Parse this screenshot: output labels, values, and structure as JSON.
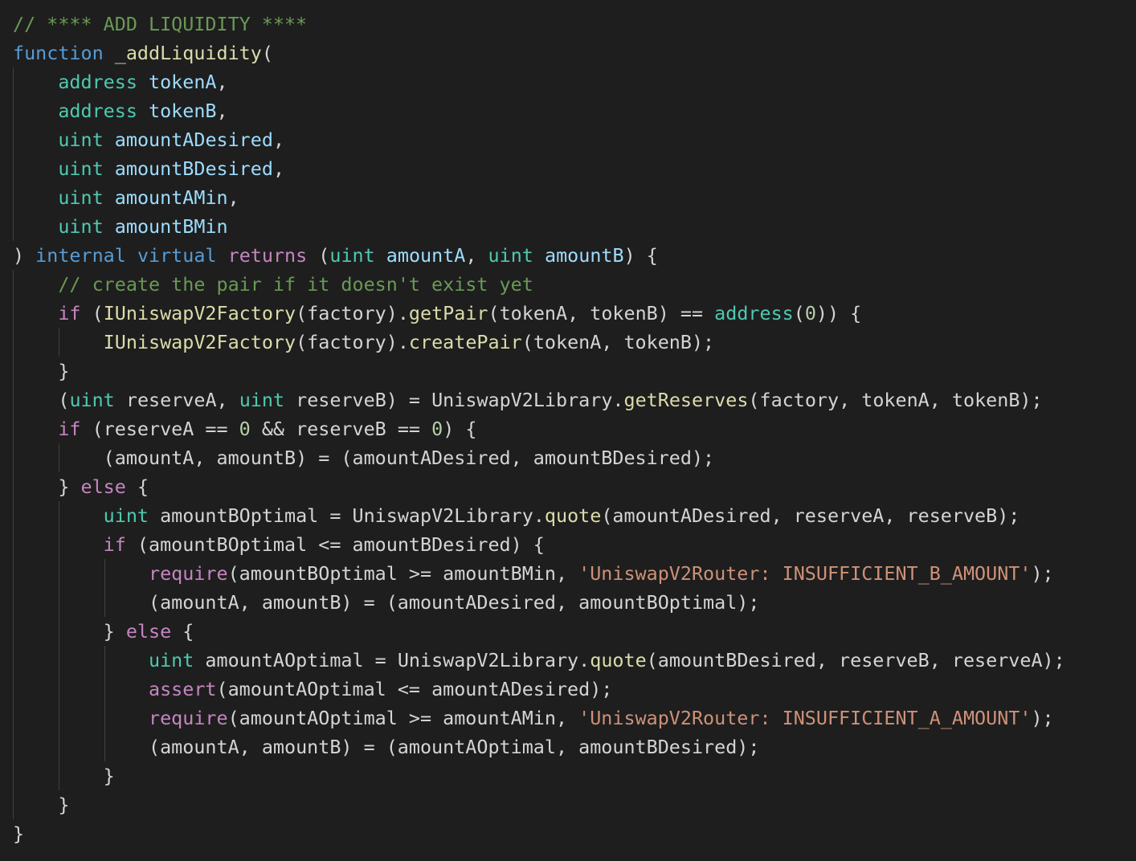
{
  "editor": {
    "language": "solidity",
    "theme": "dark",
    "colors": {
      "background": "#1e1e1e",
      "comment": "#6a9955",
      "keyword": "#569cd6",
      "control": "#c586c0",
      "type": "#4ec9b0",
      "function": "#dcdcaa",
      "variable": "#9cdcfe",
      "plain": "#d4d4d4",
      "string": "#ce9178",
      "number": "#b5cea8",
      "indent_guide": "#404040"
    },
    "lines": [
      {
        "indent": 0,
        "tokens": [
          {
            "t": "// **** ADD LIQUIDITY ****",
            "c": "comment"
          }
        ]
      },
      {
        "indent": 0,
        "tokens": [
          {
            "t": "function",
            "c": "keyword"
          },
          {
            "t": " ",
            "c": "plain"
          },
          {
            "t": "_addLiquidity",
            "c": "function"
          },
          {
            "t": "(",
            "c": "plain"
          }
        ]
      },
      {
        "indent": 1,
        "tokens": [
          {
            "t": "address",
            "c": "type"
          },
          {
            "t": " ",
            "c": "plain"
          },
          {
            "t": "tokenA",
            "c": "variable"
          },
          {
            "t": ",",
            "c": "plain"
          }
        ]
      },
      {
        "indent": 1,
        "tokens": [
          {
            "t": "address",
            "c": "type"
          },
          {
            "t": " ",
            "c": "plain"
          },
          {
            "t": "tokenB",
            "c": "variable"
          },
          {
            "t": ",",
            "c": "plain"
          }
        ]
      },
      {
        "indent": 1,
        "tokens": [
          {
            "t": "uint",
            "c": "type"
          },
          {
            "t": " ",
            "c": "plain"
          },
          {
            "t": "amountADesired",
            "c": "variable"
          },
          {
            "t": ",",
            "c": "plain"
          }
        ]
      },
      {
        "indent": 1,
        "tokens": [
          {
            "t": "uint",
            "c": "type"
          },
          {
            "t": " ",
            "c": "plain"
          },
          {
            "t": "amountBDesired",
            "c": "variable"
          },
          {
            "t": ",",
            "c": "plain"
          }
        ]
      },
      {
        "indent": 1,
        "tokens": [
          {
            "t": "uint",
            "c": "type"
          },
          {
            "t": " ",
            "c": "plain"
          },
          {
            "t": "amountAMin",
            "c": "variable"
          },
          {
            "t": ",",
            "c": "plain"
          }
        ]
      },
      {
        "indent": 1,
        "tokens": [
          {
            "t": "uint",
            "c": "type"
          },
          {
            "t": " ",
            "c": "plain"
          },
          {
            "t": "amountBMin",
            "c": "variable"
          }
        ]
      },
      {
        "indent": 0,
        "tokens": [
          {
            "t": ") ",
            "c": "plain"
          },
          {
            "t": "internal",
            "c": "keyword"
          },
          {
            "t": " ",
            "c": "plain"
          },
          {
            "t": "virtual",
            "c": "keyword"
          },
          {
            "t": " ",
            "c": "plain"
          },
          {
            "t": "returns",
            "c": "control"
          },
          {
            "t": " (",
            "c": "plain"
          },
          {
            "t": "uint",
            "c": "type"
          },
          {
            "t": " ",
            "c": "plain"
          },
          {
            "t": "amountA",
            "c": "variable"
          },
          {
            "t": ", ",
            "c": "plain"
          },
          {
            "t": "uint",
            "c": "type"
          },
          {
            "t": " ",
            "c": "plain"
          },
          {
            "t": "amountB",
            "c": "variable"
          },
          {
            "t": ") {",
            "c": "plain"
          }
        ]
      },
      {
        "indent": 1,
        "tokens": [
          {
            "t": "// create the pair if it doesn't exist yet",
            "c": "comment"
          }
        ]
      },
      {
        "indent": 1,
        "tokens": [
          {
            "t": "if",
            "c": "control"
          },
          {
            "t": " (",
            "c": "plain"
          },
          {
            "t": "IUniswapV2Factory",
            "c": "function"
          },
          {
            "t": "(factory).",
            "c": "plain"
          },
          {
            "t": "getPair",
            "c": "function"
          },
          {
            "t": "(tokenA, tokenB) == ",
            "c": "plain"
          },
          {
            "t": "address",
            "c": "type"
          },
          {
            "t": "(",
            "c": "plain"
          },
          {
            "t": "0",
            "c": "number"
          },
          {
            "t": ")) {",
            "c": "plain"
          }
        ]
      },
      {
        "indent": 2,
        "tokens": [
          {
            "t": "IUniswapV2Factory",
            "c": "function"
          },
          {
            "t": "(factory).",
            "c": "plain"
          },
          {
            "t": "createPair",
            "c": "function"
          },
          {
            "t": "(tokenA, tokenB);",
            "c": "plain"
          }
        ]
      },
      {
        "indent": 1,
        "tokens": [
          {
            "t": "}",
            "c": "plain"
          }
        ]
      },
      {
        "indent": 1,
        "tokens": [
          {
            "t": "(",
            "c": "plain"
          },
          {
            "t": "uint",
            "c": "type"
          },
          {
            "t": " reserveA, ",
            "c": "plain"
          },
          {
            "t": "uint",
            "c": "type"
          },
          {
            "t": " reserveB) = UniswapV2Library.",
            "c": "plain"
          },
          {
            "t": "getReserves",
            "c": "function"
          },
          {
            "t": "(factory, tokenA, tokenB);",
            "c": "plain"
          }
        ]
      },
      {
        "indent": 1,
        "tokens": [
          {
            "t": "if",
            "c": "control"
          },
          {
            "t": " (reserveA == ",
            "c": "plain"
          },
          {
            "t": "0",
            "c": "number"
          },
          {
            "t": " && reserveB == ",
            "c": "plain"
          },
          {
            "t": "0",
            "c": "number"
          },
          {
            "t": ") {",
            "c": "plain"
          }
        ]
      },
      {
        "indent": 2,
        "tokens": [
          {
            "t": "(amountA, amountB) = (amountADesired, amountBDesired);",
            "c": "plain"
          }
        ]
      },
      {
        "indent": 1,
        "tokens": [
          {
            "t": "} ",
            "c": "plain"
          },
          {
            "t": "else",
            "c": "control"
          },
          {
            "t": " {",
            "c": "plain"
          }
        ]
      },
      {
        "indent": 2,
        "tokens": [
          {
            "t": "uint",
            "c": "type"
          },
          {
            "t": " amountBOptimal = UniswapV2Library.",
            "c": "plain"
          },
          {
            "t": "quote",
            "c": "function"
          },
          {
            "t": "(amountADesired, reserveA, reserveB);",
            "c": "plain"
          }
        ]
      },
      {
        "indent": 2,
        "tokens": [
          {
            "t": "if",
            "c": "control"
          },
          {
            "t": " (amountBOptimal <= amountBDesired) {",
            "c": "plain"
          }
        ]
      },
      {
        "indent": 3,
        "tokens": [
          {
            "t": "require",
            "c": "control"
          },
          {
            "t": "(amountBOptimal >= amountBMin, ",
            "c": "plain"
          },
          {
            "t": "'UniswapV2Router: INSUFFICIENT_B_AMOUNT'",
            "c": "string"
          },
          {
            "t": ");",
            "c": "plain"
          }
        ]
      },
      {
        "indent": 3,
        "tokens": [
          {
            "t": "(amountA, amountB) = (amountADesired, amountBOptimal);",
            "c": "plain"
          }
        ]
      },
      {
        "indent": 2,
        "tokens": [
          {
            "t": "} ",
            "c": "plain"
          },
          {
            "t": "else",
            "c": "control"
          },
          {
            "t": " {",
            "c": "plain"
          }
        ]
      },
      {
        "indent": 3,
        "tokens": [
          {
            "t": "uint",
            "c": "type"
          },
          {
            "t": " amountAOptimal = UniswapV2Library.",
            "c": "plain"
          },
          {
            "t": "quote",
            "c": "function"
          },
          {
            "t": "(amountBDesired, reserveB, reserveA);",
            "c": "plain"
          }
        ]
      },
      {
        "indent": 3,
        "tokens": [
          {
            "t": "assert",
            "c": "control"
          },
          {
            "t": "(amountAOptimal <= amountADesired);",
            "c": "plain"
          }
        ]
      },
      {
        "indent": 3,
        "tokens": [
          {
            "t": "require",
            "c": "control"
          },
          {
            "t": "(amountAOptimal >= amountAMin, ",
            "c": "plain"
          },
          {
            "t": "'UniswapV2Router: INSUFFICIENT_A_AMOUNT'",
            "c": "string"
          },
          {
            "t": ");",
            "c": "plain"
          }
        ]
      },
      {
        "indent": 3,
        "tokens": [
          {
            "t": "(amountA, amountB) = (amountAOptimal, amountBDesired);",
            "c": "plain"
          }
        ]
      },
      {
        "indent": 2,
        "tokens": [
          {
            "t": "}",
            "c": "plain"
          }
        ]
      },
      {
        "indent": 1,
        "tokens": [
          {
            "t": "}",
            "c": "plain"
          }
        ]
      },
      {
        "indent": 0,
        "tokens": [
          {
            "t": "}",
            "c": "plain"
          }
        ]
      }
    ]
  }
}
